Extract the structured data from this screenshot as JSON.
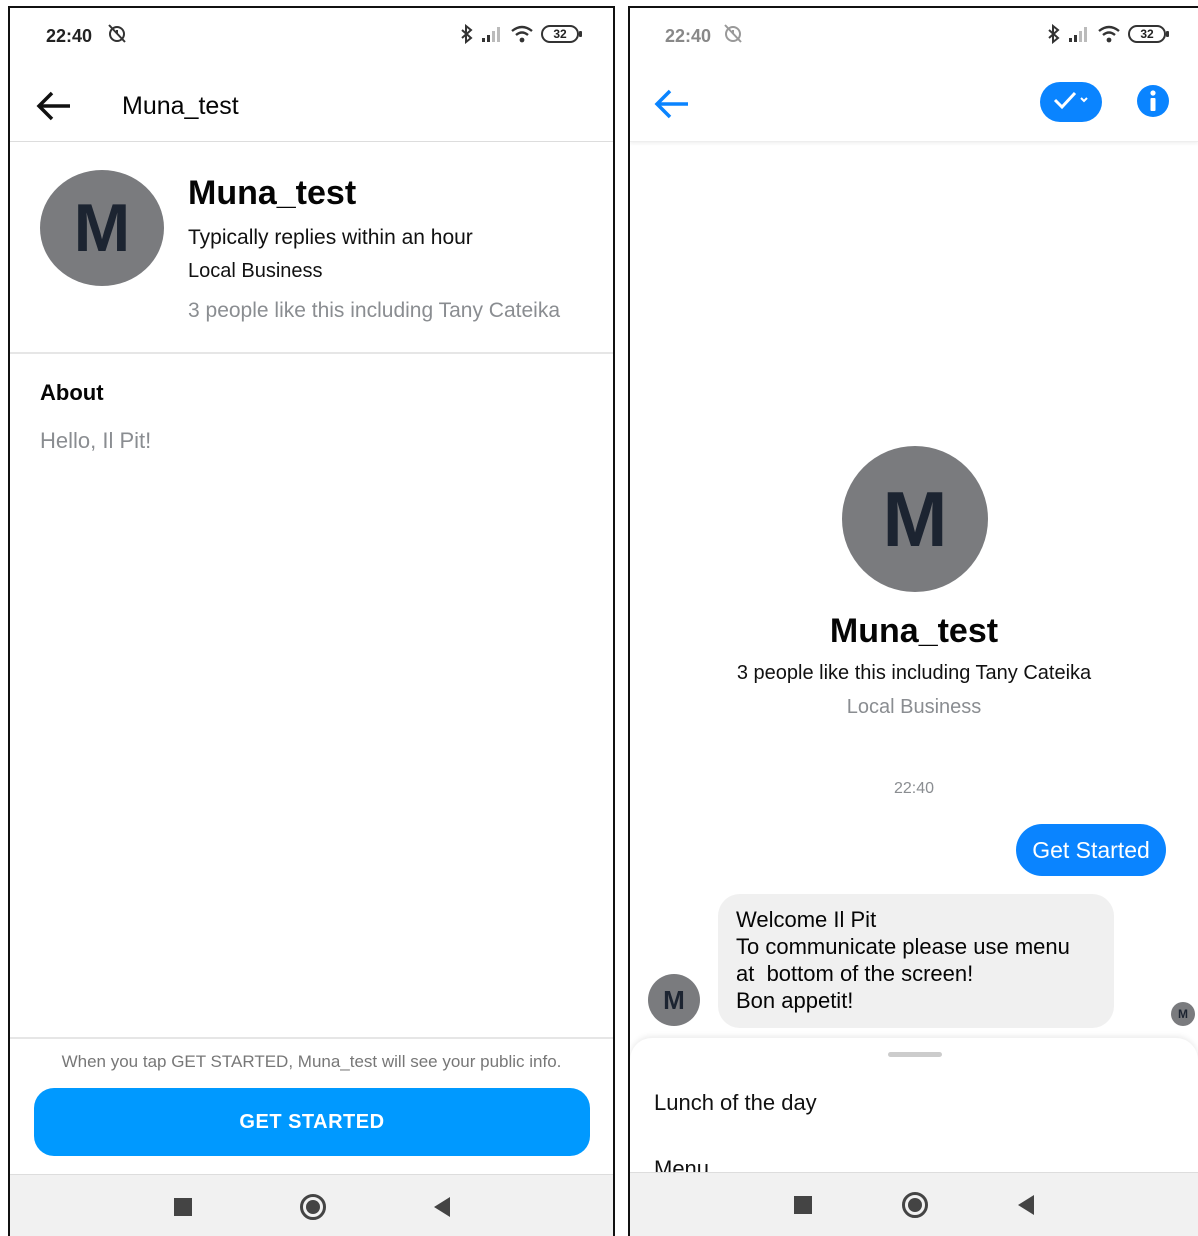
{
  "status_bar": {
    "time": "22:40",
    "battery": "32"
  },
  "left": {
    "header": {
      "title": "Muna_test"
    },
    "profile": {
      "avatar_letter": "M",
      "name": "Muna_test",
      "reply_time": "Typically replies within an hour",
      "category": "Local Business",
      "likes": "3 people like this including Tany Cateika"
    },
    "about": {
      "title": "About",
      "text": "Hello, Il Pit!"
    },
    "footer": {
      "note": "When you tap GET STARTED, Muna_test will see your public info.",
      "button_label": "GET STARTED"
    }
  },
  "right": {
    "profile": {
      "avatar_letter": "M",
      "name": "Muna_test",
      "likes": "3 people like this including Tany Cateika",
      "category": "Local Business"
    },
    "conversation": {
      "timestamp": "22:40",
      "outgoing": "Get Started",
      "incoming_lines": [
        "Welcome Il Pit",
        "To communicate please use menu",
        "at  bottom of the screen!",
        "Bon appetit!"
      ],
      "bot_avatar_letter": "M",
      "seen_avatar_letter": "M"
    },
    "menu": {
      "items": [
        "Lunch of the day",
        "Menu"
      ]
    }
  },
  "colors": {
    "accent": "#0a84ff",
    "button_blue": "#0099ff",
    "avatar_gray": "#7a7b7e",
    "secondary_text": "#8a8d91",
    "bubble_gray": "#f0f0f0"
  },
  "icons": [
    "back-arrow-icon",
    "alarm-off-icon",
    "bluetooth-icon",
    "signal-icon",
    "wifi-icon",
    "battery-icon",
    "check-icon",
    "info-icon",
    "nav-recent-icon",
    "nav-home-icon",
    "nav-back-icon"
  ]
}
